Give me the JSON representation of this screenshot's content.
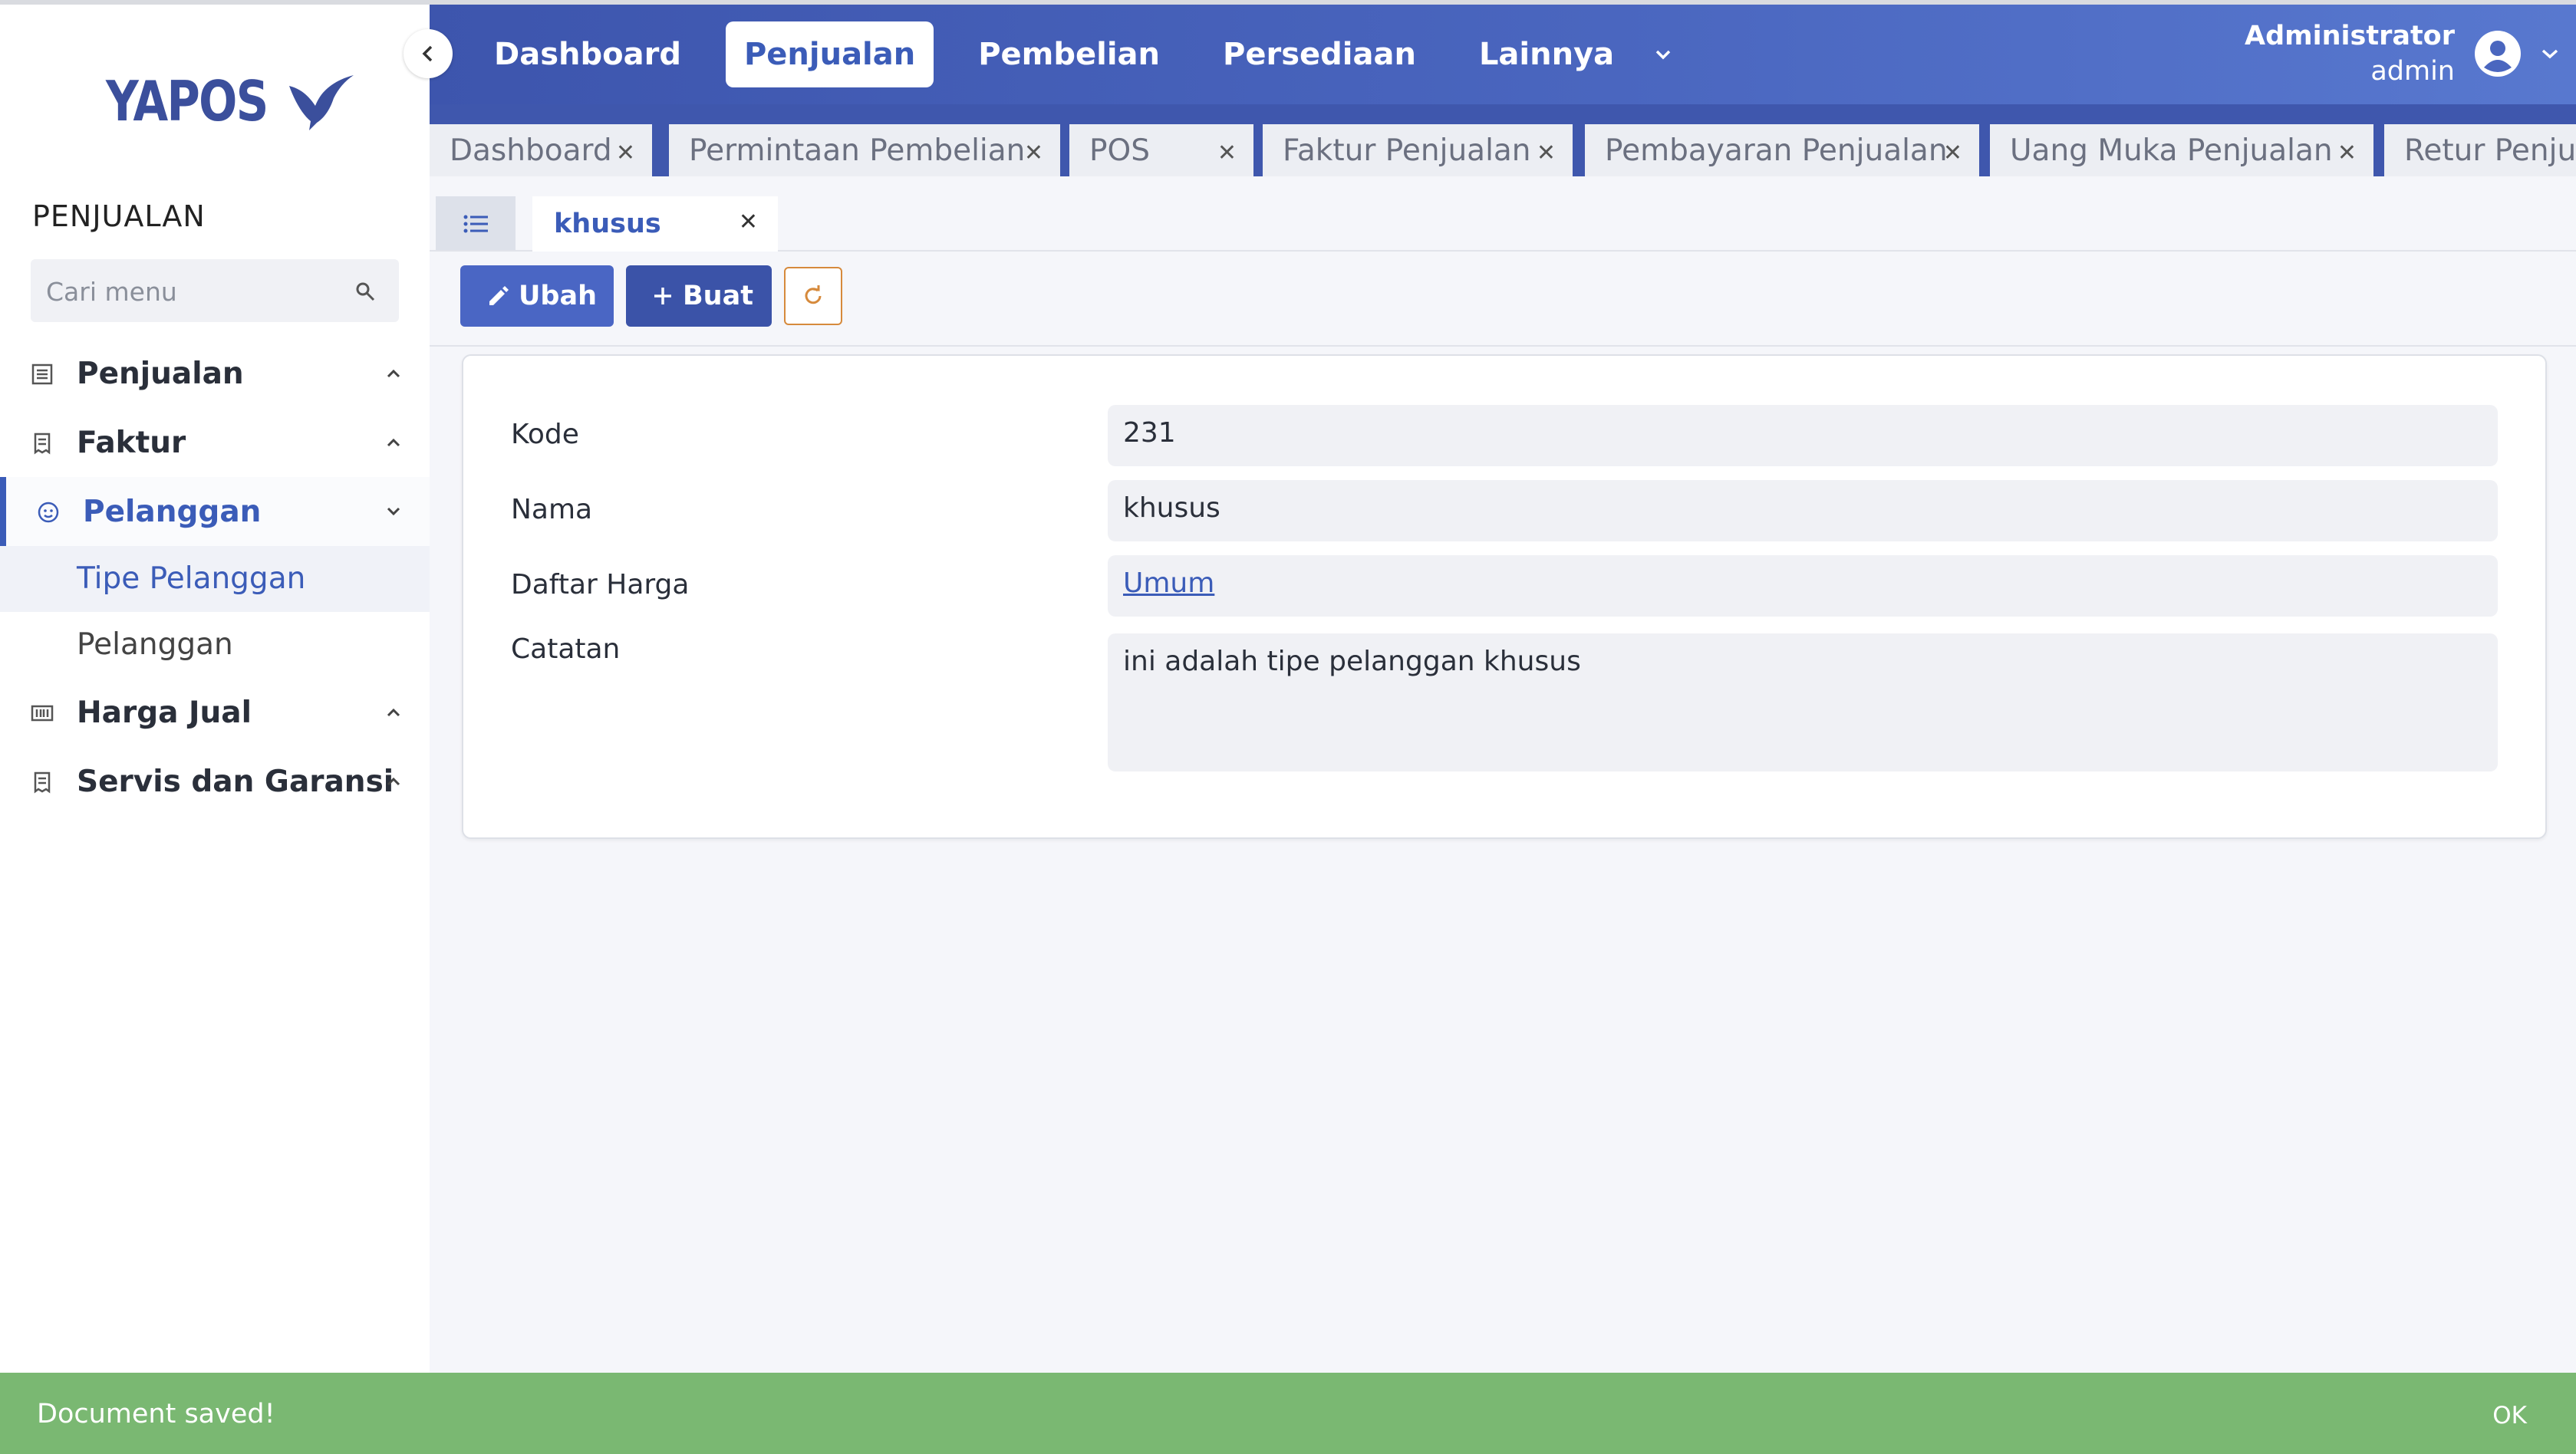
{
  "brand": {
    "logo_text": "YAPOS"
  },
  "sidebar": {
    "section_title": "PENJUALAN",
    "search_placeholder": "Cari menu",
    "items": [
      {
        "label": "Penjualan",
        "icon": "list-icon"
      },
      {
        "label": "Faktur",
        "icon": "receipt-icon"
      },
      {
        "label": "Pelanggan",
        "icon": "smile-icon",
        "expanded": true,
        "children": [
          {
            "label": "Tipe Pelanggan",
            "selected": true
          },
          {
            "label": "Pelanggan"
          }
        ]
      },
      {
        "label": "Harga Jual",
        "icon": "barcode-icon"
      },
      {
        "label": "Servis dan Garansi",
        "icon": "receipt-icon"
      }
    ]
  },
  "header": {
    "nav": [
      "Dashboard",
      "Penjualan",
      "Pembelian",
      "Persediaan",
      "Lainnya"
    ],
    "active_nav": "Penjualan",
    "user": {
      "role": "Administrator",
      "name": "admin"
    }
  },
  "open_tabs": [
    "Dashboard",
    "Permintaan Pembelian",
    "POS",
    "Faktur Penjualan",
    "Pembayaran Penjualan",
    "Uang Muka Penjualan",
    "Retur Penjua"
  ],
  "doc_tab": {
    "label": "khusus"
  },
  "toolbar": {
    "edit_label": "Ubah",
    "new_label": "Buat"
  },
  "form": {
    "kode_label": "Kode",
    "kode_value": "231",
    "nama_label": "Nama",
    "nama_value": "khusus",
    "daftar_harga_label": "Daftar Harga",
    "daftar_harga_value": "Umum",
    "catatan_label": "Catatan",
    "catatan_value": "ini adalah tipe pelanggan khusus"
  },
  "snackbar": {
    "message": "Document saved!",
    "action": "OK"
  },
  "colors": {
    "primary": "#3b5cb8",
    "header": "#4a66bf",
    "success": "#7ab872",
    "refresh_border": "#d68a3c"
  }
}
